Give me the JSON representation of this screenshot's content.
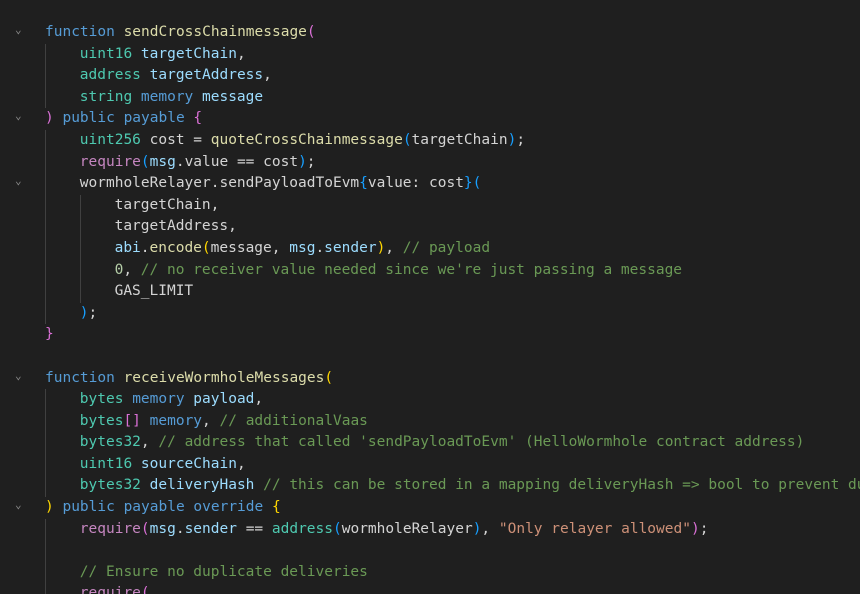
{
  "editor": {
    "lines": [
      {
        "indent": 0,
        "fold": true,
        "tokens": [
          {
            "t": "function ",
            "c": "kw"
          },
          {
            "t": "sendCrossChainmessage",
            "c": "fn"
          },
          {
            "t": "(",
            "c": "b1"
          }
        ]
      },
      {
        "indent": 1,
        "tokens": [
          {
            "t": "uint16 ",
            "c": "type"
          },
          {
            "t": "targetChain",
            "c": "param"
          },
          {
            "t": ",",
            "c": "plain"
          }
        ]
      },
      {
        "indent": 1,
        "tokens": [
          {
            "t": "address ",
            "c": "type"
          },
          {
            "t": "targetAddress",
            "c": "param"
          },
          {
            "t": ",",
            "c": "plain"
          }
        ]
      },
      {
        "indent": 1,
        "tokens": [
          {
            "t": "string ",
            "c": "type"
          },
          {
            "t": "memory ",
            "c": "kw"
          },
          {
            "t": "message",
            "c": "param"
          }
        ]
      },
      {
        "indent": 0,
        "fold": true,
        "tokens": [
          {
            "t": ")",
            "c": "b1"
          },
          {
            "t": " public payable ",
            "c": "kw"
          },
          {
            "t": "{",
            "c": "b1"
          }
        ]
      },
      {
        "indent": 1,
        "tokens": [
          {
            "t": "uint256 ",
            "c": "type"
          },
          {
            "t": "cost = ",
            "c": "plain"
          },
          {
            "t": "quoteCrossChainmessage",
            "c": "fn"
          },
          {
            "t": "(",
            "c": "b2"
          },
          {
            "t": "targetChain",
            "c": "plain"
          },
          {
            "t": ")",
            "c": "b2"
          },
          {
            "t": ";",
            "c": "plain"
          }
        ]
      },
      {
        "indent": 1,
        "tokens": [
          {
            "t": "require",
            "c": "ctrl"
          },
          {
            "t": "(",
            "c": "b2"
          },
          {
            "t": "msg",
            "c": "var"
          },
          {
            "t": ".value == cost",
            "c": "plain"
          },
          {
            "t": ")",
            "c": "b2"
          },
          {
            "t": ";",
            "c": "plain"
          }
        ]
      },
      {
        "indent": 1,
        "fold": true,
        "tokens": [
          {
            "t": "wormholeRelayer.sendPayloadToEvm",
            "c": "plain"
          },
          {
            "t": "{",
            "c": "b2"
          },
          {
            "t": "value: cost",
            "c": "plain"
          },
          {
            "t": "}",
            "c": "b2"
          },
          {
            "t": "(",
            "c": "b2"
          }
        ]
      },
      {
        "indent": 2,
        "tokens": [
          {
            "t": "targetChain,",
            "c": "plain"
          }
        ]
      },
      {
        "indent": 2,
        "tokens": [
          {
            "t": "targetAddress,",
            "c": "plain"
          }
        ]
      },
      {
        "indent": 2,
        "tokens": [
          {
            "t": "abi",
            "c": "var"
          },
          {
            "t": ".",
            "c": "plain"
          },
          {
            "t": "encode",
            "c": "fn"
          },
          {
            "t": "(",
            "c": "b3"
          },
          {
            "t": "message, ",
            "c": "plain"
          },
          {
            "t": "msg",
            "c": "var"
          },
          {
            "t": ".",
            "c": "plain"
          },
          {
            "t": "sender",
            "c": "var"
          },
          {
            "t": ")",
            "c": "b3"
          },
          {
            "t": ", ",
            "c": "plain"
          },
          {
            "t": "// payload",
            "c": "comment"
          }
        ]
      },
      {
        "indent": 2,
        "tokens": [
          {
            "t": "0",
            "c": "num"
          },
          {
            "t": ", ",
            "c": "plain"
          },
          {
            "t": "// no receiver value needed since we're just passing a message",
            "c": "comment"
          }
        ]
      },
      {
        "indent": 2,
        "tokens": [
          {
            "t": "GAS_LIMIT",
            "c": "plain"
          }
        ]
      },
      {
        "indent": 1,
        "tokens": [
          {
            "t": ")",
            "c": "b2"
          },
          {
            "t": ";",
            "c": "plain"
          }
        ]
      },
      {
        "indent": 0,
        "tokens": [
          {
            "t": "}",
            "c": "b1"
          }
        ]
      },
      {
        "indent": 0,
        "tokens": []
      },
      {
        "indent": 0,
        "fold": true,
        "tokens": [
          {
            "t": "function ",
            "c": "kw"
          },
          {
            "t": "receiveWormholeMessages",
            "c": "fn"
          },
          {
            "t": "(",
            "c": "b3"
          }
        ]
      },
      {
        "indent": 1,
        "tokens": [
          {
            "t": "bytes ",
            "c": "type"
          },
          {
            "t": "memory ",
            "c": "kw"
          },
          {
            "t": "payload",
            "c": "param"
          },
          {
            "t": ",",
            "c": "plain"
          }
        ]
      },
      {
        "indent": 1,
        "tokens": [
          {
            "t": "bytes",
            "c": "type"
          },
          {
            "t": "[]",
            "c": "b1"
          },
          {
            "t": " memory",
            "c": "kw"
          },
          {
            "t": ", ",
            "c": "plain"
          },
          {
            "t": "// additionalVaas",
            "c": "comment"
          }
        ]
      },
      {
        "indent": 1,
        "tokens": [
          {
            "t": "bytes32",
            "c": "type"
          },
          {
            "t": ", ",
            "c": "plain"
          },
          {
            "t": "// address that called 'sendPayloadToEvm' (HelloWormhole contract address)",
            "c": "comment"
          }
        ]
      },
      {
        "indent": 1,
        "tokens": [
          {
            "t": "uint16 ",
            "c": "type"
          },
          {
            "t": "sourceChain",
            "c": "param"
          },
          {
            "t": ",",
            "c": "plain"
          }
        ]
      },
      {
        "indent": 1,
        "tokens": [
          {
            "t": "bytes32 ",
            "c": "type"
          },
          {
            "t": "deliveryHash",
            "c": "param"
          },
          {
            "t": " ",
            "c": "plain"
          },
          {
            "t": "// this can be stored in a mapping deliveryHash => bool to prevent duplicate deliveries",
            "c": "comment"
          }
        ]
      },
      {
        "indent": 0,
        "fold": true,
        "tokens": [
          {
            "t": ")",
            "c": "b3"
          },
          {
            "t": " public payable override ",
            "c": "kw"
          },
          {
            "t": "{",
            "c": "b3"
          }
        ]
      },
      {
        "indent": 1,
        "tokens": [
          {
            "t": "require",
            "c": "ctrl"
          },
          {
            "t": "(",
            "c": "b1"
          },
          {
            "t": "msg",
            "c": "var"
          },
          {
            "t": ".",
            "c": "plain"
          },
          {
            "t": "sender",
            "c": "var"
          },
          {
            "t": " == ",
            "c": "plain"
          },
          {
            "t": "address",
            "c": "type"
          },
          {
            "t": "(",
            "c": "b2"
          },
          {
            "t": "wormholeRelayer",
            "c": "plain"
          },
          {
            "t": ")",
            "c": "b2"
          },
          {
            "t": ", ",
            "c": "plain"
          },
          {
            "t": "\"Only relayer allowed\"",
            "c": "str"
          },
          {
            "t": ")",
            "c": "b1"
          },
          {
            "t": ";",
            "c": "plain"
          }
        ]
      },
      {
        "indent": 1,
        "tokens": []
      },
      {
        "indent": 1,
        "tokens": [
          {
            "t": "// Ensure no duplicate deliveries",
            "c": "comment"
          }
        ]
      },
      {
        "indent": 1,
        "tokens": [
          {
            "t": "require",
            "c": "ctrl"
          },
          {
            "t": "(",
            "c": "b1"
          }
        ]
      }
    ]
  },
  "icons": {
    "fold_marker": "chevron-down-icon"
  }
}
